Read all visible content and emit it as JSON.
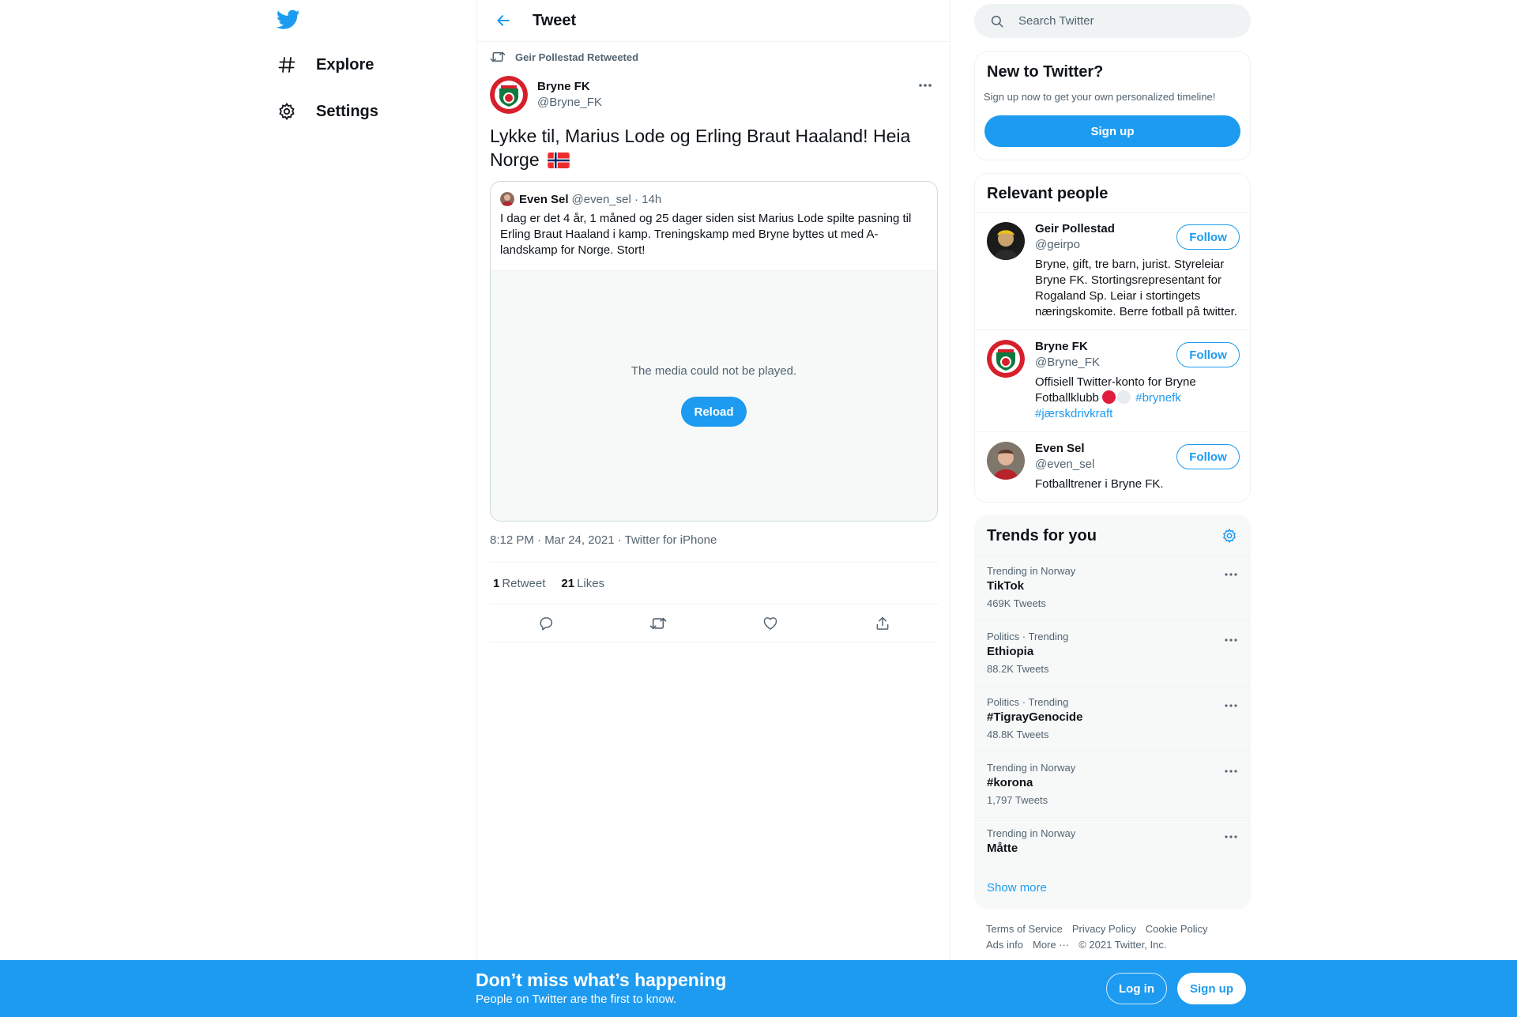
{
  "nav": {
    "items": [
      {
        "label": "Explore",
        "icon": "hashtag-icon"
      },
      {
        "label": "Settings",
        "icon": "gear-icon"
      }
    ]
  },
  "header": {
    "title": "Tweet"
  },
  "tweet": {
    "retweeted_by": "Geir Pollestad Retweeted",
    "author_name": "Bryne FK",
    "author_handle": "@Bryne_FK",
    "text": "Lykke til, Marius Lode og Erling Braut Haaland! Heia Norge",
    "flag_icon": "norway-flag-icon",
    "quote": {
      "name": "Even Sel",
      "handle_time": "@even_sel · 14h",
      "text": "I dag er det 4 år, 1 måned og 25 dager siden sist Marius Lode spilte pasning til Erling Braut Haaland i kamp. Treningskamp med Bryne byttes ut med A-landskamp for Norge. Stort!",
      "media_error": "The media could not be played.",
      "reload_label": "Reload"
    },
    "meta": "8:12 PM · Mar 24, 2021 · Twitter for iPhone",
    "retweets_count": "1",
    "retweets_label": "Retweet",
    "likes_count": "21",
    "likes_label": "Likes"
  },
  "search": {
    "placeholder": "Search Twitter"
  },
  "new_to_twitter": {
    "title": "New to Twitter?",
    "subtitle": "Sign up now to get your own personalized timeline!",
    "button": "Sign up"
  },
  "relevant_people": {
    "title": "Relevant people",
    "people": [
      {
        "name": "Geir Pollestad",
        "handle": "@geirpo",
        "bio": "Bryne, gift, tre barn, jurist. Styreleiar Bryne FK. Stortingsrepresentant for Rogaland Sp. Leiar i stortingets næringskomite. Berre fotball på twitter.",
        "follow": "Follow"
      },
      {
        "name": "Bryne FK",
        "handle": "@Bryne_FK",
        "bio_text": "Offisiell Twitter-konto for Bryne Fotballklubb",
        "bio_tags": "#brynefk #jærskdrivkraft",
        "follow": "Follow"
      },
      {
        "name": "Even Sel",
        "handle": "@even_sel",
        "bio": "Fotballtrener i Bryne FK.",
        "follow": "Follow"
      }
    ]
  },
  "trends": {
    "title": "Trends for you",
    "items": [
      {
        "context": "Trending in Norway",
        "name": "TikTok",
        "count": "469K Tweets"
      },
      {
        "context": "Politics · Trending",
        "name": "Ethiopia",
        "count": "88.2K Tweets"
      },
      {
        "context": "Politics · Trending",
        "name": "#TigrayGenocide",
        "count": "48.8K Tweets"
      },
      {
        "context": "Trending in Norway",
        "name": "#korona",
        "count": "1,797 Tweets"
      },
      {
        "context": "Trending in Norway",
        "name": "Måtte",
        "count": ""
      }
    ],
    "show_more": "Show more"
  },
  "footer": {
    "links": [
      "Terms of Service",
      "Privacy Policy",
      "Cookie Policy",
      "Ads info",
      "More ···"
    ],
    "copyright": "© 2021 Twitter, Inc."
  },
  "bottom_bar": {
    "title": "Don’t miss what’s happening",
    "subtitle": "People on Twitter are the first to know.",
    "login": "Log in",
    "signup": "Sign up"
  },
  "colors": {
    "accent": "#1d9bf0",
    "muted": "#536471",
    "text": "#0f1419",
    "bryne_red": "#e01e3c"
  }
}
